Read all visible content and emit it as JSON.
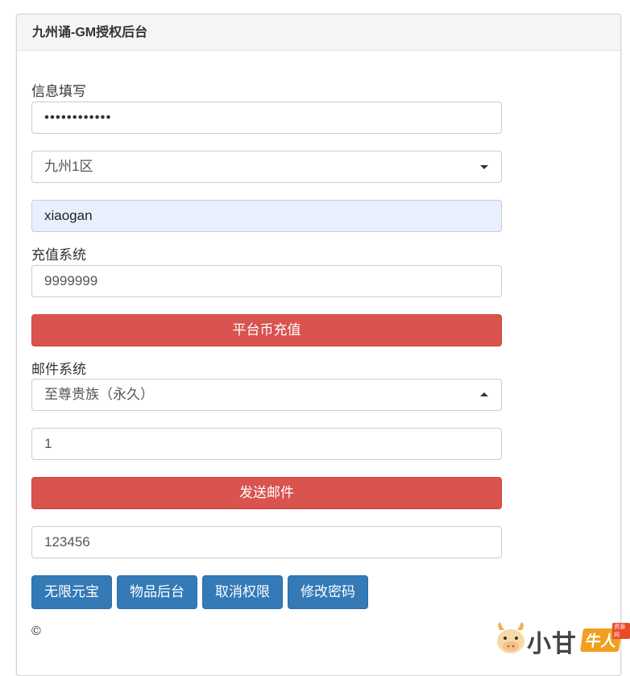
{
  "panel": {
    "title": "九州诵-GM授权后台"
  },
  "info": {
    "label": "信息填写",
    "password_value": "••••••••••••",
    "server_selected": "九州1区",
    "account_value": "xiaogan"
  },
  "recharge": {
    "label": "充值系统",
    "amount_value": "9999999",
    "button_label": "平台币充值"
  },
  "mail": {
    "label": "邮件系统",
    "item_selected": "至尊贵族（永久）",
    "quantity_value": "1",
    "button_label": "发送邮件"
  },
  "extra": {
    "code_value": "123456"
  },
  "actions": [
    {
      "label": "无限元宝"
    },
    {
      "label": "物品后台"
    },
    {
      "label": "取消权限"
    },
    {
      "label": "修改密码"
    }
  ],
  "footer": {
    "text": "©"
  },
  "watermark": {
    "text": "小甘",
    "badge": "牛人",
    "tag": "资源网"
  },
  "colors": {
    "danger": "#d9534f",
    "primary": "#337ab7",
    "autofill": "#e8f0fe"
  },
  "icons": {
    "select_caret_down": "caret-down-icon",
    "select_caret_up": "caret-up-icon",
    "watermark_logo": "cow-mascot-icon"
  }
}
